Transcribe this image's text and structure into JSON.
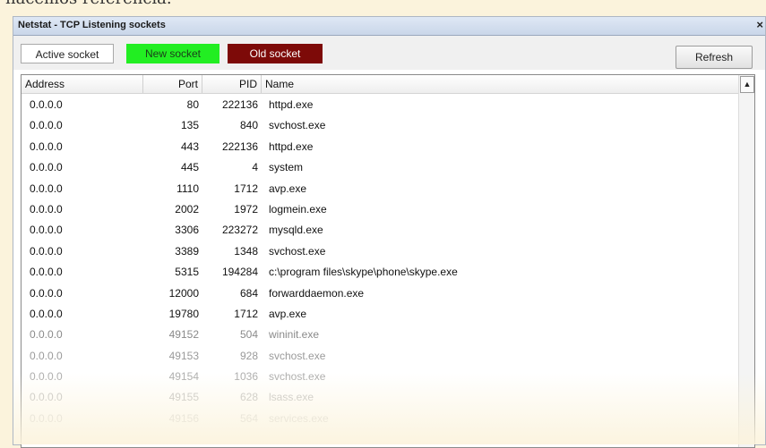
{
  "page_text": "hacemos referencia.",
  "window": {
    "title": "Netstat - TCP Listening sockets",
    "close_label": "×"
  },
  "toolbar": {
    "active_label": "Active socket",
    "new_label": "New socket",
    "old_label": "Old socket",
    "refresh_label": "Refresh"
  },
  "colors": {
    "new_socket": "#22ee22",
    "old_socket": "#7d0a08"
  },
  "table": {
    "columns": [
      "Address",
      "Port",
      "PID",
      "Name"
    ],
    "rows": [
      {
        "address": "0.0.0.0",
        "port": "80",
        "pid": "222136",
        "name": "httpd.exe",
        "state": "active"
      },
      {
        "address": "0.0.0.0",
        "port": "135",
        "pid": "840",
        "name": "svchost.exe",
        "state": "active"
      },
      {
        "address": "0.0.0.0",
        "port": "443",
        "pid": "222136",
        "name": "httpd.exe",
        "state": "active"
      },
      {
        "address": "0.0.0.0",
        "port": "445",
        "pid": "4",
        "name": "system",
        "state": "active"
      },
      {
        "address": "0.0.0.0",
        "port": "1110",
        "pid": "1712",
        "name": "avp.exe",
        "state": "active"
      },
      {
        "address": "0.0.0.0",
        "port": "2002",
        "pid": "1972",
        "name": "logmein.exe",
        "state": "active"
      },
      {
        "address": "0.0.0.0",
        "port": "3306",
        "pid": "223272",
        "name": "mysqld.exe",
        "state": "active"
      },
      {
        "address": "0.0.0.0",
        "port": "3389",
        "pid": "1348",
        "name": "svchost.exe",
        "state": "active"
      },
      {
        "address": "0.0.0.0",
        "port": "5315",
        "pid": "194284",
        "name": "c:\\program files\\skype\\phone\\skype.exe",
        "state": "active"
      },
      {
        "address": "0.0.0.0",
        "port": "12000",
        "pid": "684",
        "name": "forwarddaemon.exe",
        "state": "active"
      },
      {
        "address": "0.0.0.0",
        "port": "19780",
        "pid": "1712",
        "name": "avp.exe",
        "state": "active"
      },
      {
        "address": "0.0.0.0",
        "port": "49152",
        "pid": "504",
        "name": "wininit.exe",
        "state": "faded"
      },
      {
        "address": "0.0.0.0",
        "port": "49153",
        "pid": "928",
        "name": "svchost.exe",
        "state": "faded"
      },
      {
        "address": "0.0.0.0",
        "port": "49154",
        "pid": "1036",
        "name": "svchost.exe",
        "state": "faded"
      },
      {
        "address": "0.0.0.0",
        "port": "49155",
        "pid": "628",
        "name": "lsass.exe",
        "state": "faded"
      },
      {
        "address": "0.0.0.0",
        "port": "49156",
        "pid": "564",
        "name": "services.exe",
        "state": "faded"
      }
    ]
  },
  "icons": {
    "scroll_up": "scroll-up-arrow-icon"
  }
}
